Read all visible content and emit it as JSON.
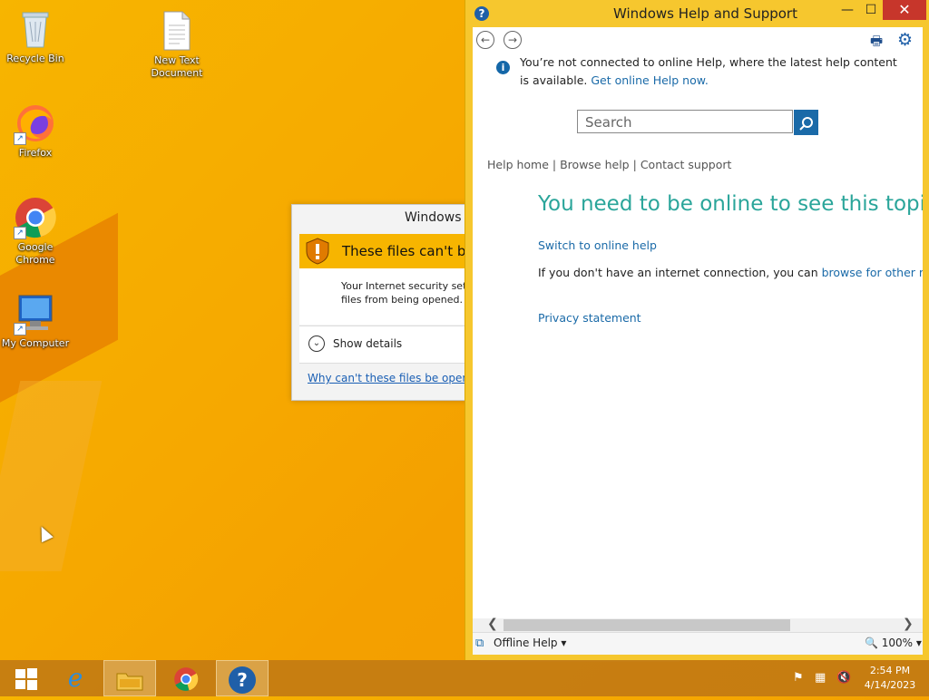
{
  "desktop": {
    "icons": [
      {
        "label": "Recycle Bin",
        "icon": "recycle-bin-icon"
      },
      {
        "label": "New Text Document",
        "icon": "text-document-icon"
      },
      {
        "label": "Firefox",
        "icon": "firefox-icon"
      },
      {
        "label": "Google Chrome",
        "icon": "chrome-icon"
      },
      {
        "label": "My Computer",
        "icon": "computer-icon"
      }
    ]
  },
  "security_dialog": {
    "title": "Windows S",
    "warning": "These files can't be o",
    "body_line1": "Your Internet security sett",
    "body_line2": "files from being opened.",
    "show_details": "Show details",
    "link": "Why can't these files be opened?"
  },
  "help_window": {
    "title": "Windows Help and Support",
    "info_text": "You’re not connected to online Help, where the latest help content is available.",
    "info_link": "Get online Help now.",
    "search_placeholder": "Search",
    "crumbs": {
      "home": "Help home",
      "browse": "Browse help",
      "contact": "Contact support",
      "sep": "|"
    },
    "headline": "You need to be online to see this topic",
    "switch_link": "Switch to online help",
    "offline_text": "If you don't have an internet connection, you can",
    "offline_link": "browse for other related",
    "privacy_link": "Privacy statement",
    "status": {
      "mode": "Offline Help",
      "zoom": "100%"
    }
  },
  "taskbar": {
    "clock_time": "2:54 PM",
    "clock_date": "4/14/2023",
    "apps": [
      "start-icon",
      "internet-explorer-icon",
      "file-explorer-icon",
      "chrome-icon",
      "help-icon"
    ]
  },
  "colors": {
    "desktop": "#f7b500",
    "accent": "#1a6aa8",
    "headline": "#2aa59a",
    "close": "#c7362b"
  }
}
